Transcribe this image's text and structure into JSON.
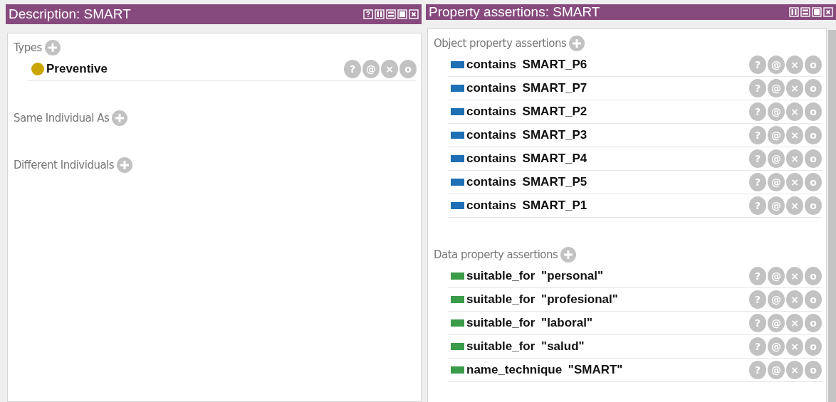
{
  "panels": [
    {
      "title": "Description: SMART",
      "window_buttons": [
        {
          "kind": "help"
        },
        {
          "kind": "split_v"
        },
        {
          "kind": "split_h"
        },
        {
          "kind": "maximize"
        },
        {
          "kind": "close"
        }
      ],
      "scrollbar": false,
      "sections": [
        {
          "label": "Types",
          "items": [
            {
              "kind": "class",
              "text": "Preventive",
              "buttons": [
                "?",
                "@",
                "×",
                "o"
              ]
            }
          ]
        },
        {
          "label": "Same Individual As"
        },
        {
          "label": "Different Individuals"
        }
      ]
    },
    {
      "title": "Property assertions: SMART",
      "window_buttons": [
        {
          "kind": "split_v"
        },
        {
          "kind": "split_h"
        },
        {
          "kind": "maximize"
        },
        {
          "kind": "close"
        }
      ],
      "scrollbar": true,
      "sections": [
        {
          "label": "Object property assertions",
          "items": [
            {
              "kind": "object",
              "text": "contains SMART_P6",
              "buttons": [
                "?",
                "@",
                "×",
                "o"
              ]
            },
            {
              "kind": "object",
              "text": "contains SMART_P7",
              "buttons": [
                "?",
                "@",
                "×",
                "o"
              ]
            },
            {
              "kind": "object",
              "text": "contains SMART_P2",
              "buttons": [
                "?",
                "@",
                "×",
                "o"
              ]
            },
            {
              "kind": "object",
              "text": "contains SMART_P3",
              "buttons": [
                "?",
                "@",
                "×",
                "o"
              ]
            },
            {
              "kind": "object",
              "text": "contains SMART_P4",
              "buttons": [
                "?",
                "@",
                "×",
                "o"
              ]
            },
            {
              "kind": "object",
              "text": "contains SMART_P5",
              "buttons": [
                "?",
                "@",
                "×",
                "o"
              ]
            },
            {
              "kind": "object",
              "text": "contains SMART_P1",
              "buttons": [
                "?",
                "@",
                "×",
                "o"
              ]
            }
          ]
        },
        {
          "label": "Data property assertions",
          "items": [
            {
              "kind": "data",
              "text": "suitable_for \"personal\"",
              "buttons": [
                "?",
                "@",
                "×",
                "o"
              ]
            },
            {
              "kind": "data",
              "text": "suitable_for \"profesional\"",
              "buttons": [
                "?",
                "@",
                "×",
                "o"
              ]
            },
            {
              "kind": "data",
              "text": "suitable_for \"laboral\"",
              "buttons": [
                "?",
                "@",
                "×",
                "o"
              ]
            },
            {
              "kind": "data",
              "text": "suitable_for \"salud\"",
              "buttons": [
                "?",
                "@",
                "×",
                "o"
              ]
            },
            {
              "kind": "data",
              "text": "name_technique \"SMART\"",
              "buttons": [
                "?",
                "@",
                "×",
                "o"
              ]
            }
          ]
        }
      ]
    }
  ]
}
